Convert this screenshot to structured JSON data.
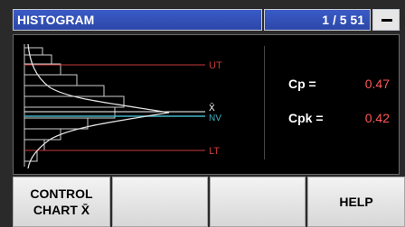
{
  "header": {
    "title": "HISTOGRAM",
    "page": "1 / 5  51"
  },
  "chart": {
    "labels": {
      "ut": "UT",
      "xbar": "X̄",
      "nv": "NV",
      "lt": "LT"
    }
  },
  "stats": {
    "cp_label": "Cp  =",
    "cp_value": "0.47",
    "cpk_label": "Cpk =",
    "cpk_value": "0.42"
  },
  "softkeys": {
    "control_chart_line1": "CONTROL",
    "control_chart_line2": "CHART X̄",
    "help": "HELP"
  },
  "colors": {
    "limit": "#c83a3a",
    "nv": "#3fb4c7",
    "value": "#ff5757",
    "header": "#2c47a8"
  }
}
